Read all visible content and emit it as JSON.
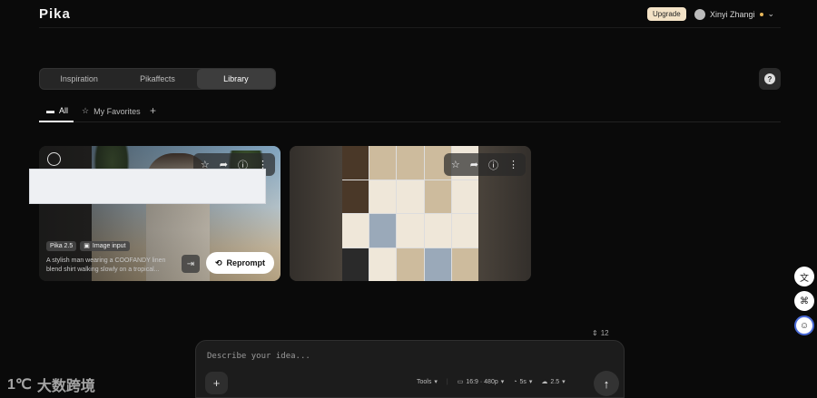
{
  "header": {
    "logo": "Pika",
    "upgrade_label": "Upgrade",
    "user_name": "Xinyi Zhangi"
  },
  "nav": {
    "tabs": [
      {
        "label": "Inspiration",
        "active": false
      },
      {
        "label": "Pikaffects",
        "active": false
      },
      {
        "label": "Library",
        "active": true
      }
    ]
  },
  "subtabs": {
    "all_label": "All",
    "favorites_label": "My Favorites",
    "add_label": "+"
  },
  "cards": [
    {
      "chips": [
        "Pika 2.5",
        "Image input"
      ],
      "prompt": "A stylish man wearing a COOFANDY linen blend shirt walking slowly on a tropical...",
      "reprompt_label": "Reprompt"
    },
    {
      "chips": [],
      "prompt": ""
    }
  ],
  "composer": {
    "counter": "12",
    "placeholder": "Describe your idea...",
    "tools_label": "Tools",
    "aspect_label": "16:9 · 480p",
    "duration_label": "5s",
    "model_label": "2.5"
  },
  "watermark": "大数跨境",
  "colors": {
    "background": "#0a0a0a",
    "upgrade_bg": "#f3e2c6",
    "panel": "#1c1c1c"
  }
}
